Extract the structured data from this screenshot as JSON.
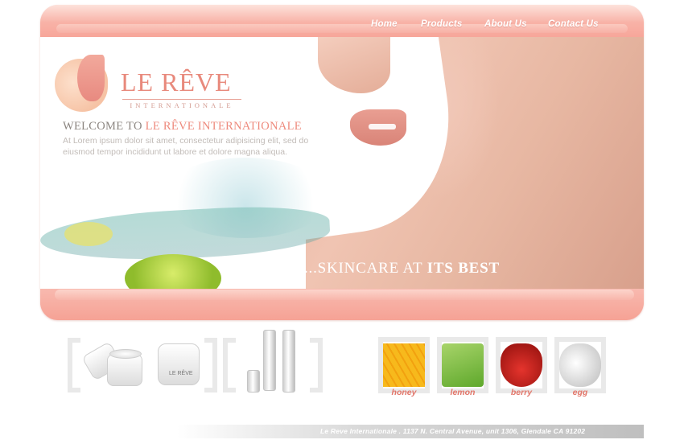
{
  "nav": {
    "items": [
      {
        "label": "Home"
      },
      {
        "label": "Products"
      },
      {
        "label": "About Us"
      },
      {
        "label": "Contact Us"
      }
    ]
  },
  "logo": {
    "name": "LE RÊVE",
    "subtitle": "INTERNATIONALE"
  },
  "welcome": {
    "prefix": "WELCOME TO",
    "brand": "LE RÊVE INTERNATIONALE",
    "body": "At Lorem ipsum dolor sit amet, consectetur adipisicing elit, sed do eiusmod tempor incididunt ut labore et dolore magna aliqua."
  },
  "tagline": {
    "lead": "...SKINCARE AT",
    "emphasis": "ITS BEST"
  },
  "products": {
    "jar_label": "LE RÊVE"
  },
  "ingredients": [
    {
      "label": "honey",
      "icon": "honey-icon"
    },
    {
      "label": "lemon",
      "icon": "lemon-icon"
    },
    {
      "label": "berry",
      "icon": "strawberry-icon"
    },
    {
      "label": "egg",
      "icon": "egg-icon"
    }
  ],
  "footer": {
    "address": "Le Reve Internationale . 1137 N. Central Avenue, unit 1306, Glendale CA 91202"
  },
  "colors": {
    "accent": "#f6a79b",
    "brand_text": "#ee8a7d",
    "ingredient_label": "#e3776b"
  }
}
